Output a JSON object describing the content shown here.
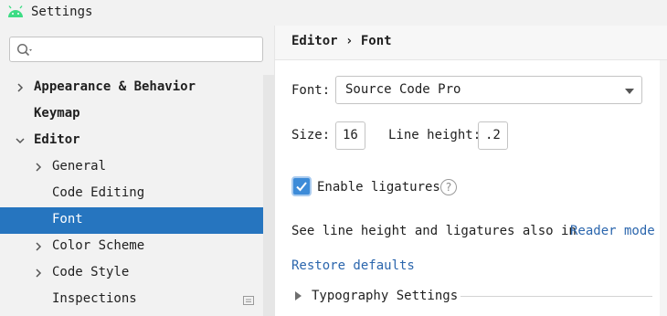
{
  "window": {
    "title": "Settings"
  },
  "search": {
    "placeholder": "",
    "value": ""
  },
  "sidebar": {
    "items": [
      {
        "label": "Appearance & Behavior"
      },
      {
        "label": "Keymap"
      },
      {
        "label": "Editor"
      },
      {
        "label": "General"
      },
      {
        "label": "Code Editing"
      },
      {
        "label": "Font"
      },
      {
        "label": "Color Scheme"
      },
      {
        "label": "Code Style"
      },
      {
        "label": "Inspections"
      }
    ]
  },
  "header": {
    "breadcrumb": "Editor › Font"
  },
  "font_settings": {
    "font_label": "Font:",
    "font_value": "Source Code Pro",
    "size_label": "Size:",
    "size_value": "16",
    "line_height_label": "Line height:",
    "line_height_value": ".2",
    "ligatures_label": "Enable ligatures",
    "ligatures_checked": true,
    "help_glyph": "?",
    "info_text": "See line height and ligatures also in",
    "reader_mode_link": "Reader mode",
    "restore_defaults": "Restore defaults",
    "typography_settings": "Typography Settings"
  },
  "colors": {
    "accent": "#2675bf",
    "link": "#2b66ad",
    "checkbox": "#3d8bd8",
    "android_green": "#3ddc84"
  },
  "icons": {
    "app": "android-icon",
    "search": "search-icon",
    "chevron_right": "chevron-right-icon",
    "chevron_down": "chevron-down-icon",
    "dropdown": "dropdown-arrow-icon",
    "checkmark": "checkmark-icon",
    "help": "help-icon",
    "project_settings": "project-settings-icon",
    "expand": "triangle-right-icon"
  }
}
